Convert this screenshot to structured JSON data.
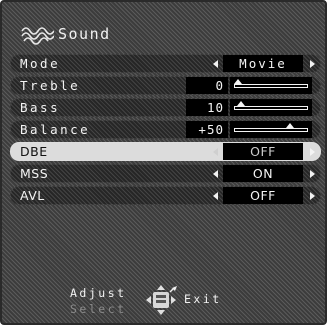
{
  "menu": {
    "title": "Sound",
    "title_icon": "sound-wave-icon"
  },
  "rows": {
    "mode": {
      "label": "Mode",
      "value": "Movie"
    },
    "treble": {
      "label": "Treble",
      "value": "0",
      "level_percent": 0
    },
    "bass": {
      "label": "Bass",
      "value": "10",
      "level_percent": 10
    },
    "balance": {
      "label": "Balance",
      "value": "+50",
      "level_percent": 75
    },
    "dbe": {
      "label": "DBE",
      "value": "OFF",
      "highlighted": true
    },
    "mss": {
      "label": "MSS",
      "value": "ON"
    },
    "avl": {
      "label": "AVL",
      "value": "OFF"
    }
  },
  "hints": {
    "adjust": "Adjust",
    "select": "Select",
    "exit": "Exit",
    "remote_icon": "remote-dpad-icon"
  },
  "colors": {
    "highlight_row": "#dcdcdc",
    "value_box": "#000000",
    "text": "#f4f4f4"
  }
}
